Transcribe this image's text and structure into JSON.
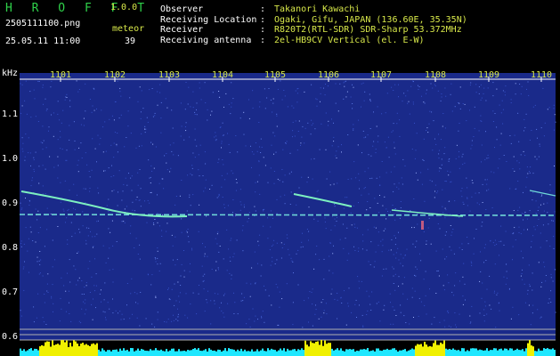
{
  "header": {
    "app_title": "H R O F F T",
    "version": "1.0.0",
    "filename": "2505111100.png",
    "datetime": "25.05.11 11:00",
    "meteor_label": "meteor",
    "meteor_count": "39",
    "info": [
      {
        "key": "Observer",
        "value": "Takanori Kawachi"
      },
      {
        "key": "Receiving Location",
        "value": "Ogaki, Gifu, JAPAN (136.60E, 35.35N)"
      },
      {
        "key": "Receiver",
        "value": "R820T2(RTL-SDR) SDR-Sharp 53.372MHz"
      },
      {
        "key": "Receiving antenna",
        "value": "2el-HB9CV Vertical (el. E-W)"
      }
    ]
  },
  "axis": {
    "unit": "kHz",
    "x_ticks": [
      "1101",
      "1102",
      "1103",
      "1104",
      "1105",
      "1106",
      "1107",
      "1108",
      "1109",
      "1110"
    ],
    "y_ticks": [
      "1.1",
      "1.0",
      "0.9",
      "0.8",
      "0.7",
      "0.6"
    ]
  },
  "colors": {
    "background": "#1a2a8a",
    "trace": "#7df0c0",
    "bar": "#1fe7ff",
    "bar_peak": "#f0f000"
  }
}
